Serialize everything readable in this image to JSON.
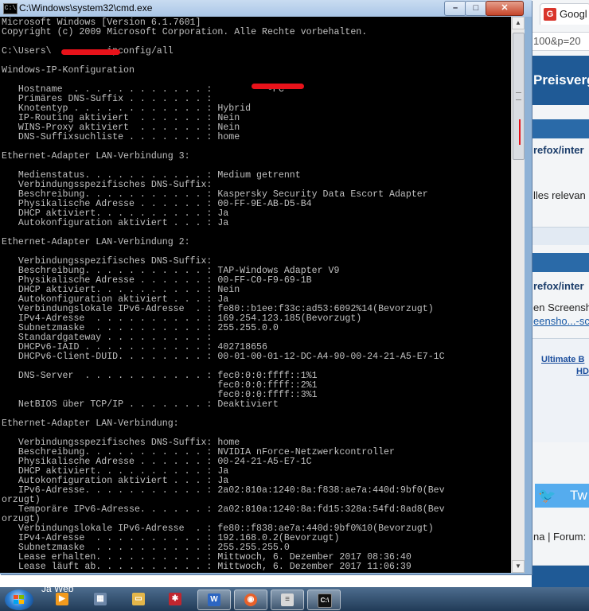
{
  "window": {
    "title": "C:\\Windows\\system32\\cmd.exe"
  },
  "console_lines": [
    "Microsoft Windows [Version 6.1.7601]",
    "Copyright (c) 2009 Microsoft Corporation. Alle Rechte vorbehalten.",
    "",
    "C:\\Users\\          ipconfig/all",
    "",
    "Windows-IP-Konfiguration",
    "",
    "   Hostname  . . . . . . . . . . . . :          -PC",
    "   Primäres DNS-Suffix . . . . . . . :",
    "   Knotentyp . . . . . . . . . . . . : Hybrid",
    "   IP-Routing aktiviert  . . . . . . : Nein",
    "   WINS-Proxy aktiviert  . . . . . . : Nein",
    "   DNS-Suffixsuchliste . . . . . . . : home",
    "",
    "Ethernet-Adapter LAN-Verbindung 3:",
    "",
    "   Medienstatus. . . . . . . . . . . : Medium getrennt",
    "   Verbindungsspezifisches DNS-Suffix:",
    "   Beschreibung. . . . . . . . . . . : Kaspersky Security Data Escort Adapter",
    "   Physikalische Adresse . . . . . . : 00-FF-9E-AB-D5-B4",
    "   DHCP aktiviert. . . . . . . . . . : Ja",
    "   Autokonfiguration aktiviert . . . : Ja",
    "",
    "Ethernet-Adapter LAN-Verbindung 2:",
    "",
    "   Verbindungsspezifisches DNS-Suffix:",
    "   Beschreibung. . . . . . . . . . . : TAP-Windows Adapter V9",
    "   Physikalische Adresse . . . . . . : 00-FF-C0-F9-69-1B",
    "   DHCP aktiviert. . . . . . . . . . : Nein",
    "   Autokonfiguration aktiviert . . . : Ja",
    "   Verbindungslokale IPv6-Adresse  . : fe80::b1ee:f33c:ad53:6092%14(Bevorzugt)",
    "   IPv4-Adresse  . . . . . . . . . . : 169.254.123.185(Bevorzugt)",
    "   Subnetzmaske  . . . . . . . . . . : 255.255.0.0",
    "   Standardgateway . . . . . . . . . :",
    "   DHCPv6-IAID . . . . . . . . . . . : 402718656",
    "   DHCPv6-Client-DUID. . . . . . . . : 00-01-00-01-12-DC-A4-90-00-24-21-A5-E7-1C",
    "",
    "   DNS-Server  . . . . . . . . . . . : fec0:0:0:ffff::1%1",
    "                                       fec0:0:0:ffff::2%1",
    "                                       fec0:0:0:ffff::3%1",
    "   NetBIOS über TCP/IP . . . . . . . : Deaktiviert",
    "",
    "Ethernet-Adapter LAN-Verbindung:",
    "",
    "   Verbindungsspezifisches DNS-Suffix: home",
    "   Beschreibung. . . . . . . . . . . : NVIDIA nForce-Netzwerkcontroller",
    "   Physikalische Adresse . . . . . . : 00-24-21-A5-E7-1C",
    "   DHCP aktiviert. . . . . . . . . . : Ja",
    "   Autokonfiguration aktiviert . . . : Ja",
    "   IPv6-Adresse. . . . . . . . . . . : 2a02:810a:1240:8a:f838:ae7a:440d:9bf0(Bev",
    "orzugt)",
    "   Temporäre IPv6-Adresse. . . . . . : 2a02:810a:1240:8a:fd15:328a:54fd:8ad8(Bev",
    "orzugt)",
    "   Verbindungslokale IPv6-Adresse  . : fe80::f838:ae7a:440d:9bf0%10(Bevorzugt)",
    "   IPv4-Adresse  . . . . . . . . . . : 192.168.0.2(Bevorzugt)",
    "   Subnetzmaske  . . . . . . . . . . : 255.255.255.0",
    "   Lease erhalten. . . . . . . . . . : Mittwoch, 6. Dezember 2017 08:36:40",
    "   Lease läuft ab. . . . . . . . . . : Mittwoch, 6. Dezember 2017 11:06:39"
  ],
  "browser": {
    "tab_label": "Googl",
    "tab_icon": "G",
    "url_fragment": "100&p=20",
    "banner_text": "Preisvergl",
    "path1": "refox/inter",
    "snippet1": "lles relevan",
    "path2": "refox/inter",
    "snippet2": "en Screensh",
    "link2": "eensho...-sc",
    "bold_link_1": "Ultimate B",
    "bold_link_2": "HD",
    "twitter_label": "Tw",
    "forum_text": "na | Forum:"
  },
  "taskbar": {
    "preview_text": "Ja           Web"
  },
  "colors": {
    "console_bg": "#000000",
    "console_fg": "#c0c0c0",
    "redaction": "#e8121a",
    "banner": "#1f5a96",
    "twitter": "#55acee"
  }
}
